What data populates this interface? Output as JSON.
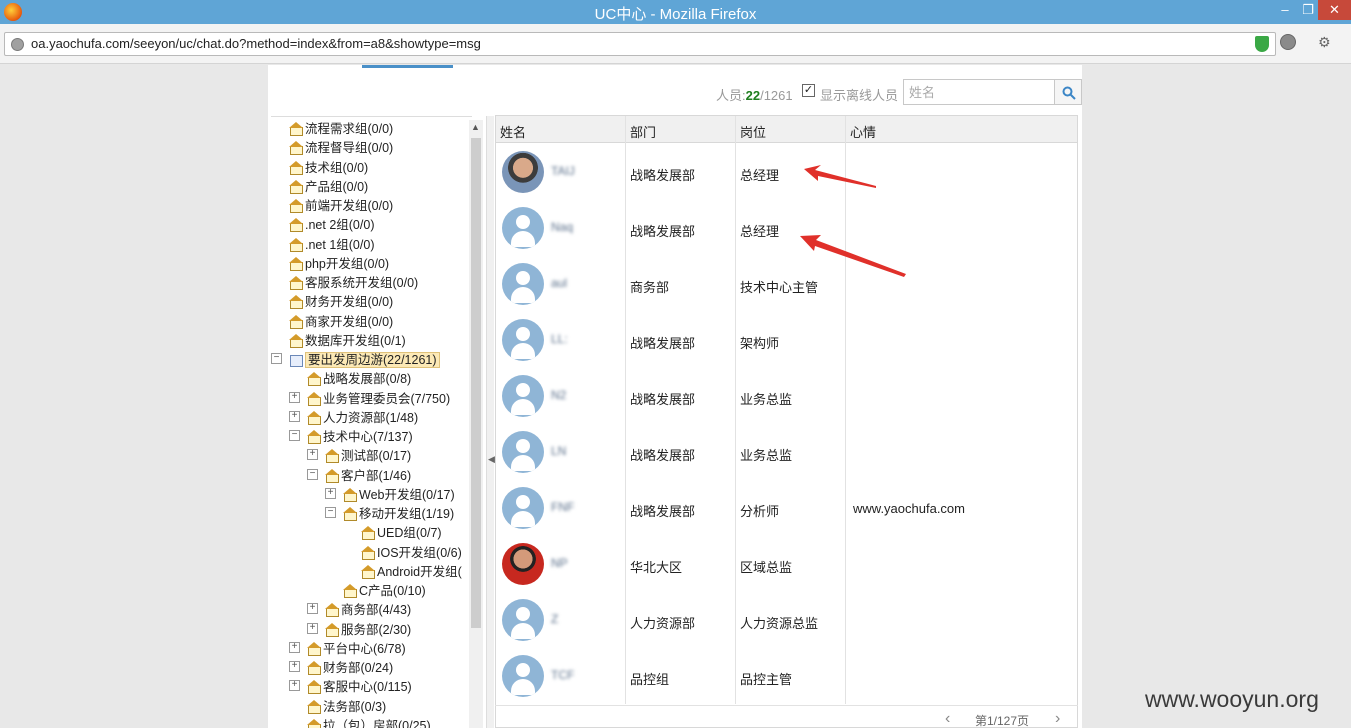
{
  "window": {
    "title": "UC中心 - Mozilla Firefox"
  },
  "address": {
    "url": "oa.yaochufa.com/seeyon/uc/chat.do?method=index&from=a8&showtype=msg"
  },
  "toolbar": {
    "count_prefix": "人员:",
    "online_count": "22",
    "total_count": "/1261",
    "show_offline_label": "显示离线人员",
    "show_offline_checked": true,
    "search_placeholder": "姓名"
  },
  "tree": [
    {
      "label": "流程需求组(0/0)",
      "level": 0
    },
    {
      "label": "流程督导组(0/0)",
      "level": 0
    },
    {
      "label": "技术组(0/0)",
      "level": 0
    },
    {
      "label": "产品组(0/0)",
      "level": 0
    },
    {
      "label": "前端开发组(0/0)",
      "level": 0
    },
    {
      "label": ".net 2组(0/0)",
      "level": 0
    },
    {
      "label": ".net 1组(0/0)",
      "level": 0
    },
    {
      "label": "php开发组(0/0)",
      "level": 0
    },
    {
      "label": "客服系统开发组(0/0)",
      "level": 0
    },
    {
      "label": "财务开发组(0/0)",
      "level": 0
    },
    {
      "label": "商家开发组(0/0)",
      "level": 0
    },
    {
      "label": "数据库开发组(0/1)",
      "level": 0
    },
    {
      "label": "要出发周边游(22/1261)",
      "level": 0,
      "toggle": "−",
      "selected": true,
      "root": true
    },
    {
      "label": "战略发展部(0/8)",
      "level": 1
    },
    {
      "label": "业务管理委员会(7/750)",
      "level": 1,
      "toggle": "+"
    },
    {
      "label": "人力资源部(1/48)",
      "level": 1,
      "toggle": "+"
    },
    {
      "label": "技术中心(7/137)",
      "level": 1,
      "toggle": "−"
    },
    {
      "label": "测试部(0/17)",
      "level": 2,
      "toggle": "+"
    },
    {
      "label": "客户部(1/46)",
      "level": 2,
      "toggle": "−"
    },
    {
      "label": "Web开发组(0/17)",
      "level": 3,
      "toggle": "+"
    },
    {
      "label": "移动开发组(1/19)",
      "level": 3,
      "toggle": "−"
    },
    {
      "label": "UED组(0/7)",
      "level": 4
    },
    {
      "label": "IOS开发组(0/6)",
      "level": 4
    },
    {
      "label": "Android开发组(",
      "level": 4
    },
    {
      "label": "C产品(0/10)",
      "level": 3
    },
    {
      "label": "商务部(4/43)",
      "level": 2,
      "toggle": "+"
    },
    {
      "label": "服务部(2/30)",
      "level": 2,
      "toggle": "+"
    },
    {
      "label": "平台中心(6/78)",
      "level": 1,
      "toggle": "+"
    },
    {
      "label": "财务部(0/24)",
      "level": 1,
      "toggle": "+"
    },
    {
      "label": "客服中心(0/115)",
      "level": 1,
      "toggle": "+"
    },
    {
      "label": "法务部(0/3)",
      "level": 1
    },
    {
      "label": "拉（包）房部(0/25)",
      "level": 1
    }
  ],
  "grid": {
    "headers": [
      "姓名",
      "部门",
      "岗位",
      "心情"
    ],
    "rows": [
      {
        "avatar": "photo",
        "name": "TAIJ",
        "dept": "战略发展部",
        "post": "总经理",
        "mood": ""
      },
      {
        "avatar": "default",
        "name": "Naq",
        "dept": "战略发展部",
        "post": "总经理",
        "mood": ""
      },
      {
        "avatar": "default",
        "name": "aul",
        "dept": "商务部",
        "post": "技术中心主管",
        "mood": ""
      },
      {
        "avatar": "default",
        "name": "LL:",
        "dept": "战略发展部",
        "post": "架构师",
        "mood": ""
      },
      {
        "avatar": "default",
        "name": "N2",
        "dept": "战略发展部",
        "post": "业务总监",
        "mood": ""
      },
      {
        "avatar": "default",
        "name": "LN",
        "dept": "战略发展部",
        "post": "业务总监",
        "mood": ""
      },
      {
        "avatar": "default",
        "name": "FNF",
        "dept": "战略发展部",
        "post": "分析师",
        "mood": "www.yaochufa.com"
      },
      {
        "avatar": "photo2",
        "name": "NP",
        "dept": "华北大区",
        "post": "区域总监",
        "mood": ""
      },
      {
        "avatar": "default",
        "name": "Z",
        "dept": "人力资源部",
        "post": "人力资源总监",
        "mood": ""
      },
      {
        "avatar": "default",
        "name": "TCF",
        "dept": "品控组",
        "post": "品控主管",
        "mood": ""
      }
    ]
  },
  "pager": {
    "page_text": "第1/127页"
  },
  "watermark": "www.wooyun.org",
  "colors": {
    "accent": "#4a90c8",
    "online": "#1e7e1e",
    "arrow": "#e0302a",
    "titlebar": "#5fa5d6"
  }
}
